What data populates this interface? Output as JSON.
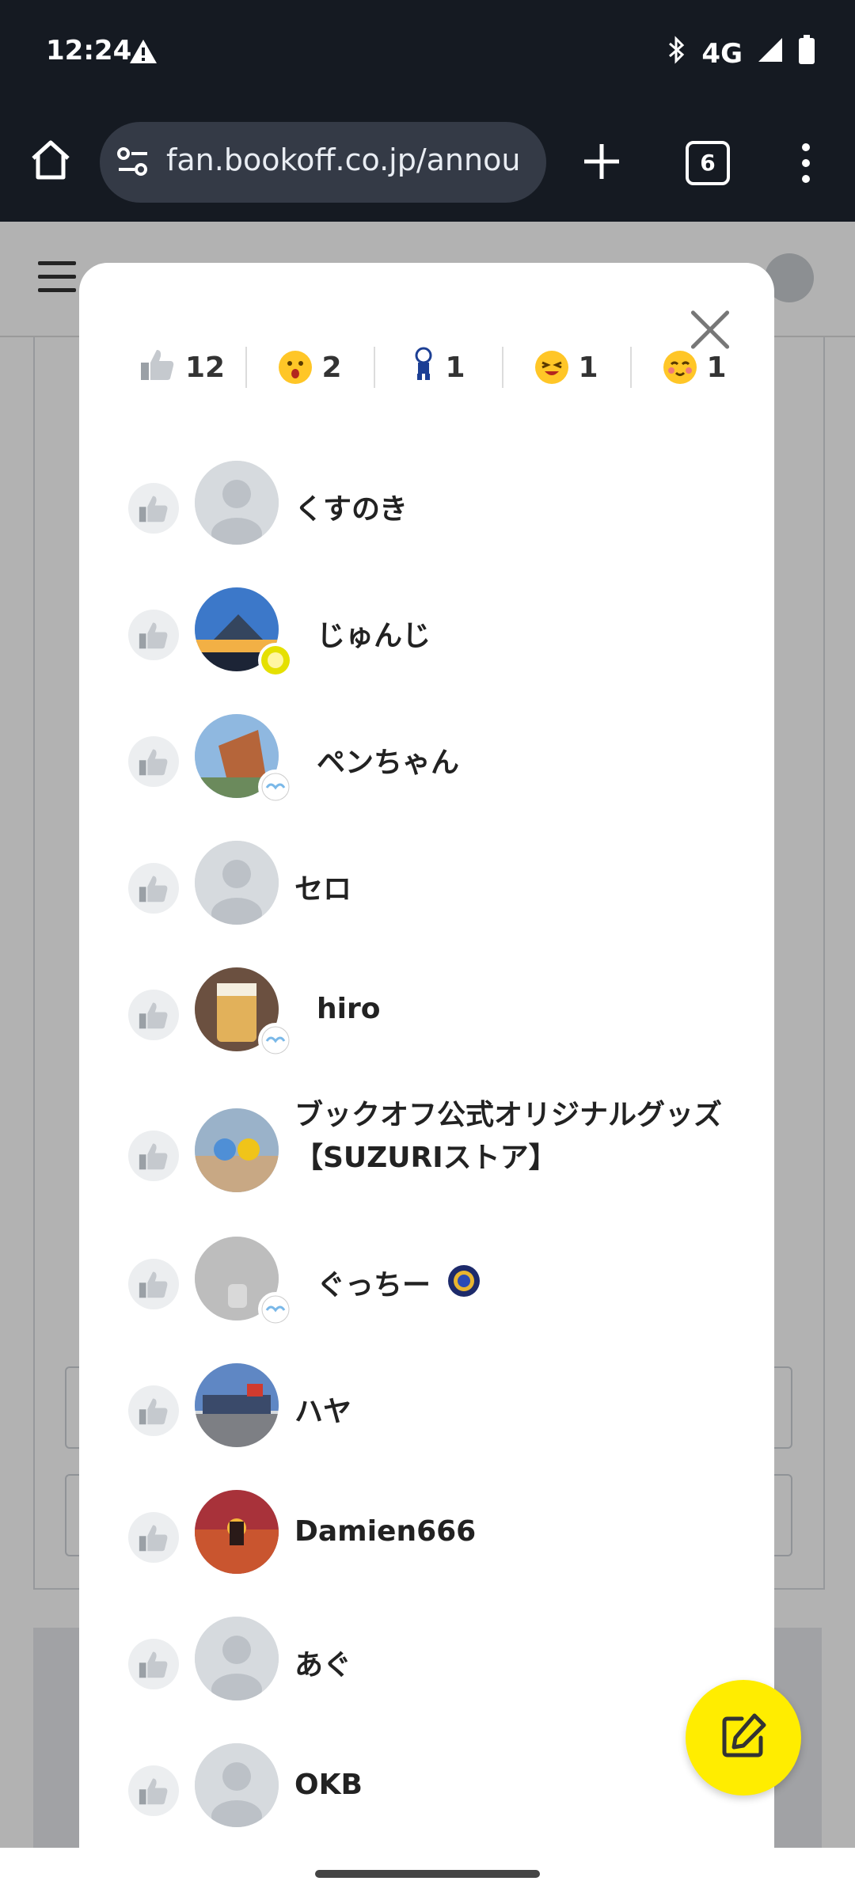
{
  "status_bar": {
    "time": "12:24",
    "network": "4G",
    "icons": [
      "warning-icon",
      "bluetooth-icon",
      "signal-icon",
      "battery-icon"
    ]
  },
  "browser": {
    "url": "fan.bookoff.co.jp/annou",
    "tab_count": "6"
  },
  "reaction_tabs": [
    {
      "icon": "thumbs-up-icon",
      "count": "12"
    },
    {
      "icon": "surprised-emoji-icon",
      "count": "2"
    },
    {
      "icon": "character-icon",
      "count": "1"
    },
    {
      "icon": "laughing-emoji-icon",
      "count": "1"
    },
    {
      "icon": "blushing-emoji-icon",
      "count": "1"
    }
  ],
  "users": [
    {
      "name": "くすのき",
      "avatar": "default"
    },
    {
      "name": "じゅんじ",
      "avatar": "mountain"
    },
    {
      "name": "ペンちゃん",
      "avatar": "building"
    },
    {
      "name": "セロ",
      "avatar": "default"
    },
    {
      "name": "hiro",
      "avatar": "drink"
    },
    {
      "name": "ブックオフ公式オリジナルグッズ【SUZURIストア】",
      "avatar": "goods"
    },
    {
      "name": "ぐっちー",
      "avatar": "grey"
    },
    {
      "name": "ハヤ",
      "avatar": "store"
    },
    {
      "name": "Damien666",
      "avatar": "sunset"
    },
    {
      "name": "あぐ",
      "avatar": "default"
    },
    {
      "name": "OKB",
      "avatar": "default"
    }
  ],
  "colors": {
    "accent_yellow": "#ffed00",
    "dark_bar": "#151a22"
  }
}
